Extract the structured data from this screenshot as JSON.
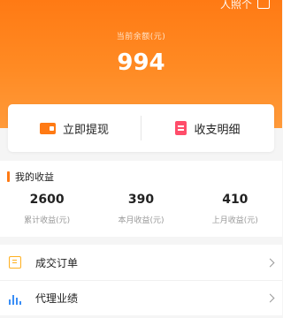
{
  "header": {
    "corner_text": "人照个",
    "balance_label": "当前余额(元)",
    "balance_value": "994"
  },
  "actions": [
    {
      "label": "立即提现",
      "icon": "wallet-icon"
    },
    {
      "label": "收支明细",
      "icon": "bill-icon"
    }
  ],
  "income": {
    "title": "我的收益",
    "stats": [
      {
        "value": "2600",
        "label": "累计收益(元)"
      },
      {
        "value": "390",
        "label": "本月收益(元)"
      },
      {
        "value": "410",
        "label": "上月收益(元)"
      }
    ]
  },
  "menu": [
    {
      "label": "成交订单",
      "icon": "orders-icon"
    },
    {
      "label": "代理业绩",
      "icon": "bar-chart-icon"
    }
  ],
  "colors": {
    "primary": "#ff7a14",
    "bill": "#ff4d6a",
    "orders": "#ffb020",
    "perf": "#3a8ef6"
  }
}
